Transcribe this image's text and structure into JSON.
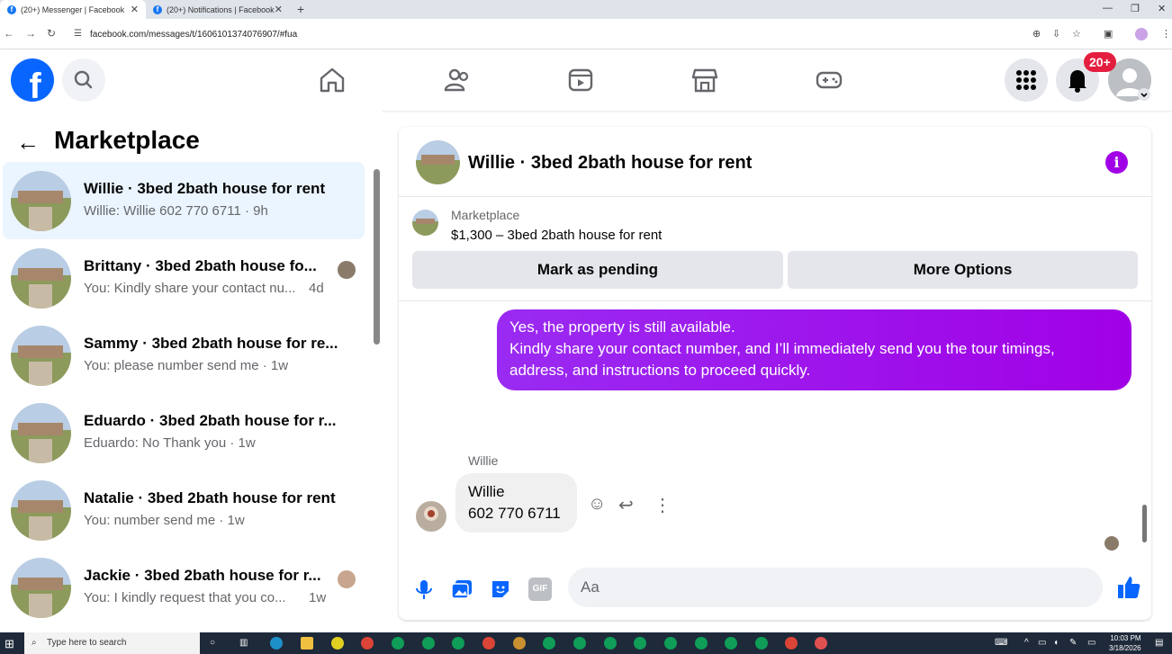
{
  "browser": {
    "tabs": [
      {
        "title": "(20+) Messenger | Facebook",
        "close": "✕"
      },
      {
        "title": "(20+) Notifications | Facebook",
        "close": "✕"
      }
    ],
    "new_tab": "+",
    "url": "facebook.com/messages/t/1606101374076907/#fua"
  },
  "header": {
    "notification_badge": "20+"
  },
  "sidebar": {
    "title": "Marketplace",
    "conversations": [
      {
        "name": "Willie · 3bed 2bath house for rent",
        "preview": "Willie: Willie 602 770 6711 · 9h",
        "time": ""
      },
      {
        "name": "Brittany · 3bed 2bath house fo...",
        "preview": "You: Kindly share your contact nu...",
        "time": "4d"
      },
      {
        "name": "Sammy · 3bed 2bath house for re...",
        "preview": "You: please number send me · 1w",
        "time": ""
      },
      {
        "name": "Eduardo · 3bed 2bath house for r...",
        "preview": "Eduardo: No Thank you · 1w",
        "time": ""
      },
      {
        "name": "Natalie · 3bed 2bath house for rent",
        "preview": "You: number send me · 1w",
        "time": ""
      },
      {
        "name": "Jackie · 3bed 2bath house for r...",
        "preview": "You: I kindly request that you co...",
        "time": "1w"
      }
    ]
  },
  "chat": {
    "title": "Willie · 3bed 2bath house for rent",
    "listing_label": "Marketplace",
    "listing_price": "$1,300 – 3bed 2bath house for rent",
    "mark_pending": "Mark as pending",
    "more_options": "More Options",
    "outgoing": {
      "line1": "Yes, the property is still available.",
      "line2": "Kindly share your contact number, and I’ll immediately send you the tour timings,",
      "line3": "address, and instructions to proceed quickly."
    },
    "incoming_sender": "Willie",
    "incoming": {
      "line1": "Willie",
      "line2": "602 770 6711"
    },
    "composer_placeholder": "Aa",
    "gif_label": "GIF"
  },
  "taskbar": {
    "search_placeholder": "Type here to search",
    "time": "10:03 PM",
    "date": "3/18/2026"
  },
  "colors": {
    "fb_blue": "#0866ff",
    "messenger_purple": "#a100e6",
    "badge_red": "#e41e3f"
  }
}
